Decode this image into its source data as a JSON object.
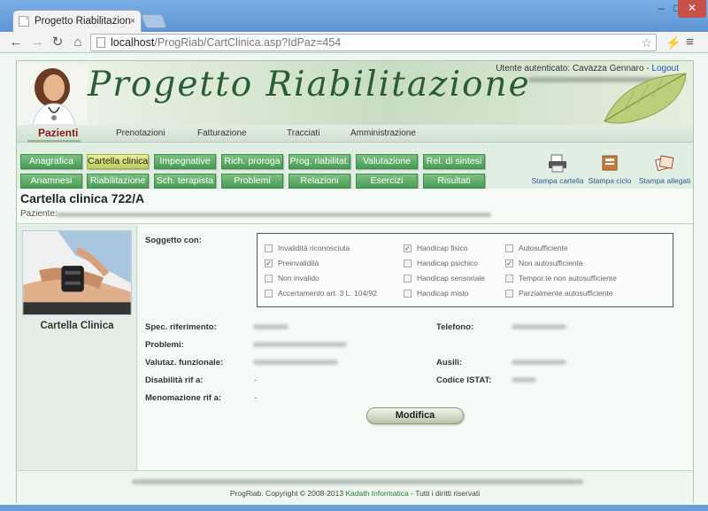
{
  "browser": {
    "tab_title": "Progetto Riabilitazione",
    "tab_close": "×",
    "url_host": "localhost",
    "url_path": "/ProgRiab/CartClinica.asp?IdPaz=454",
    "win_min": "–",
    "win_max": "□",
    "win_close": "✕",
    "nav_back": "←",
    "nav_forward": "→",
    "nav_reload": "↻",
    "nav_home": "⌂",
    "star": "☆",
    "ext_icon": "⚡",
    "menu_icon": "≡"
  },
  "header": {
    "logo_text": "Progetto Riabilitazione",
    "user_prefix": "Utente autenticato: Cavazza Gennaro - ",
    "logout_label": "Logout"
  },
  "main_nav": [
    "Pazienti",
    "Prenotazioni",
    "Fatturazione",
    "Tracciati",
    "Amministrazione"
  ],
  "sub_nav": {
    "row1": [
      "Anagrafica",
      "Cartella clinica",
      "Impegnative",
      "Rich. proroga",
      "Prog. riabilitat.",
      "Valutazione",
      "Rel. di sintesi"
    ],
    "row2": [
      "Anamnesi",
      "Riabilitazione",
      "Sch. terapista",
      "Problemi",
      "Relazioni",
      "Esercizi",
      "Risultati"
    ],
    "selected": "Cartella clinica"
  },
  "print_actions": [
    "Stampa cartella",
    "Stampa ciclo",
    "Stampa allegati"
  ],
  "page": {
    "title": "Cartella clinica 722/A",
    "paziente_label": "Paziente:"
  },
  "sidebar": {
    "caption": "Cartella Clinica"
  },
  "form": {
    "soggetto_label": "Soggetto con:",
    "checkboxes": [
      {
        "label": "Invalidità riconosciuta",
        "checked": false,
        "mark": ""
      },
      {
        "label": "Preinvalidità",
        "checked": true,
        "mark": "✓"
      },
      {
        "label": "Non invalido",
        "checked": false,
        "mark": ""
      },
      {
        "label": "Accertamento art. 3 L. 104/92",
        "checked": false,
        "mark": ""
      },
      {
        "label": "Handicap fisico",
        "checked": true,
        "mark": "✓"
      },
      {
        "label": "Handicap psichico",
        "checked": false,
        "mark": ""
      },
      {
        "label": "Handicap sensoriale",
        "checked": false,
        "mark": ""
      },
      {
        "label": "Handicap misto",
        "checked": false,
        "mark": ""
      },
      {
        "label": "Autosufficiente",
        "checked": false,
        "mark": ""
      },
      {
        "label": "Non autosufficiente",
        "checked": true,
        "mark": "✓"
      },
      {
        "label": "Tempor.te non autosufficiente",
        "checked": false,
        "mark": ""
      },
      {
        "label": "Parzialmente autosufficiente",
        "checked": false,
        "mark": ""
      }
    ],
    "spec_label": "Spec. riferimento:",
    "telefono_label": "Telefono:",
    "problemi_label": "Problemi:",
    "valutaz_label": "Valutaz. funzionale:",
    "ausili_label": "Ausili:",
    "disabilita_label": "Disabilità rif a:",
    "disabilita_value": "-",
    "codice_label": "Codice ISTAT:",
    "menomazione_label": "Menomazione rif a:",
    "menomazione_value": "-",
    "modifica_label": "Modifica"
  },
  "footer": {
    "copy_prefix": "ProgRiab. Copyright © 2008-2013 ",
    "company": "Kadath Informatica",
    "copy_suffix": " - Tutti i diritti riservati"
  },
  "colors": {
    "accent_green": "#469e52",
    "selected_yellow": "#bccf5a",
    "active_nav": "#8c1a1a",
    "logout_blue": "#1f56b8"
  }
}
